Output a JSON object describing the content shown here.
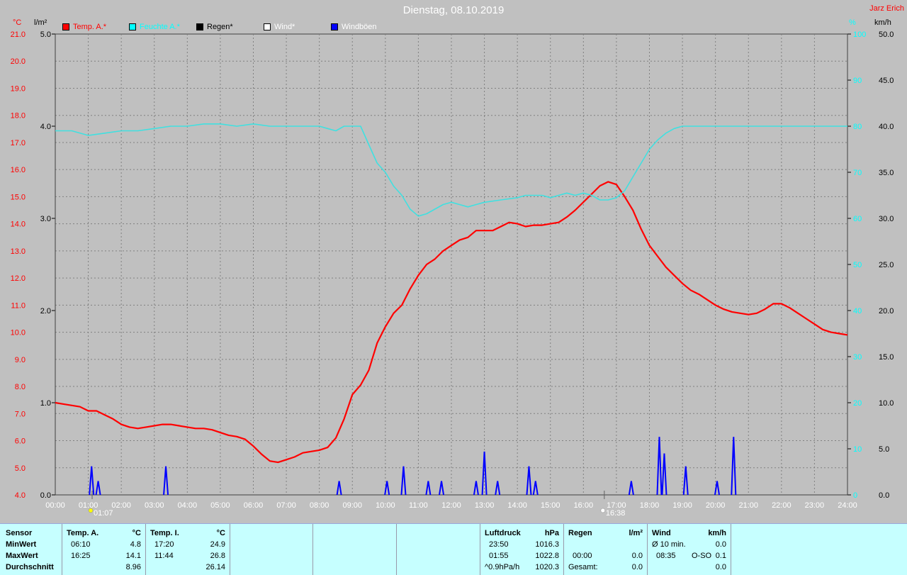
{
  "header": {
    "title": "Dienstag, 08.10.2019",
    "author": "Jarz Erich"
  },
  "units": {
    "temp": "°C",
    "rain": "l/m²",
    "humidity": "%",
    "wind": "km/h"
  },
  "legend": [
    {
      "label": "Temp. A.*",
      "color": "#ff0000"
    },
    {
      "label": "Feuchte A.*",
      "color": "#00ffff"
    },
    {
      "label": "Regen*",
      "color": "#000000"
    },
    {
      "label": "Wind*",
      "color": "#ffffff"
    },
    {
      "label": "Windböen",
      "color": "#0000ff"
    }
  ],
  "colors": {
    "background": "#c0c0c0",
    "temp": "#ff0000",
    "humidity": "#40e0e0",
    "gust": "#0000ff",
    "grid": "#808080",
    "table": "#c6ffff"
  },
  "markers": {
    "sunrise": "01:07",
    "sunset": "16:38"
  },
  "chart_data": {
    "type": "line",
    "xlabel": "",
    "x_ticks": [
      "00:00",
      "01:00",
      "02:00",
      "03:00",
      "04:00",
      "05:00",
      "06:00",
      "07:00",
      "08:00",
      "09:00",
      "10:00",
      "11:00",
      "12:00",
      "13:00",
      "14:00",
      "15:00",
      "16:00",
      "17:00",
      "18:00",
      "19:00",
      "20:00",
      "21:00",
      "22:00",
      "23:00",
      "24:00"
    ],
    "y_axes": {
      "temp": {
        "unit": "°C",
        "range": [
          4.0,
          21.0
        ],
        "ticks": [
          "4.0",
          "5.0",
          "6.0",
          "7.0",
          "8.0",
          "9.0",
          "10.0",
          "11.0",
          "12.0",
          "13.0",
          "14.0",
          "15.0",
          "16.0",
          "17.0",
          "18.0",
          "19.0",
          "20.0",
          "21.0"
        ]
      },
      "rain": {
        "unit": "l/m²",
        "range": [
          0.0,
          5.0
        ],
        "ticks": [
          "0.0",
          "1.0",
          "2.0",
          "3.0",
          "4.0",
          "5.0"
        ]
      },
      "humidity": {
        "unit": "%",
        "range": [
          0,
          100
        ],
        "ticks": [
          "0",
          "10",
          "20",
          "30",
          "40",
          "50",
          "60",
          "70",
          "80",
          "90",
          "100"
        ]
      },
      "wind": {
        "unit": "km/h",
        "range": [
          0.0,
          50.0
        ],
        "ticks": [
          "0.0",
          "5.0",
          "10.0",
          "15.0",
          "20.0",
          "25.0",
          "30.0",
          "35.0",
          "40.0",
          "45.0",
          "50.0"
        ]
      }
    },
    "grid": true,
    "series": [
      {
        "name": "Temp. A.*",
        "axis": "temp",
        "points": [
          [
            0,
            7.4
          ],
          [
            0.25,
            7.35
          ],
          [
            0.5,
            7.3
          ],
          [
            0.75,
            7.25
          ],
          [
            1,
            7.1
          ],
          [
            1.25,
            7.1
          ],
          [
            1.5,
            6.95
          ],
          [
            1.75,
            6.8
          ],
          [
            2,
            6.6
          ],
          [
            2.25,
            6.5
          ],
          [
            2.5,
            6.45
          ],
          [
            2.75,
            6.5
          ],
          [
            3,
            6.55
          ],
          [
            3.25,
            6.6
          ],
          [
            3.5,
            6.6
          ],
          [
            3.75,
            6.55
          ],
          [
            4,
            6.5
          ],
          [
            4.25,
            6.45
          ],
          [
            4.5,
            6.45
          ],
          [
            4.75,
            6.4
          ],
          [
            5,
            6.3
          ],
          [
            5.25,
            6.2
          ],
          [
            5.5,
            6.15
          ],
          [
            5.75,
            6.05
          ],
          [
            6,
            5.8
          ],
          [
            6.25,
            5.5
          ],
          [
            6.5,
            5.25
          ],
          [
            6.75,
            5.2
          ],
          [
            7,
            5.3
          ],
          [
            7.25,
            5.4
          ],
          [
            7.5,
            5.55
          ],
          [
            7.75,
            5.6
          ],
          [
            8,
            5.65
          ],
          [
            8.25,
            5.75
          ],
          [
            8.5,
            6.1
          ],
          [
            8.75,
            6.8
          ],
          [
            9,
            7.7
          ],
          [
            9.25,
            8.05
          ],
          [
            9.5,
            8.6
          ],
          [
            9.75,
            9.6
          ],
          [
            10,
            10.2
          ],
          [
            10.25,
            10.7
          ],
          [
            10.5,
            11.0
          ],
          [
            10.75,
            11.6
          ],
          [
            11,
            12.1
          ],
          [
            11.25,
            12.5
          ],
          [
            11.5,
            12.7
          ],
          [
            11.75,
            13.0
          ],
          [
            12,
            13.2
          ],
          [
            12.25,
            13.4
          ],
          [
            12.5,
            13.5
          ],
          [
            12.75,
            13.75
          ],
          [
            13,
            13.75
          ],
          [
            13.25,
            13.75
          ],
          [
            13.5,
            13.9
          ],
          [
            13.75,
            14.05
          ],
          [
            14,
            14.0
          ],
          [
            14.25,
            13.9
          ],
          [
            14.5,
            13.95
          ],
          [
            14.75,
            13.95
          ],
          [
            15,
            14.0
          ],
          [
            15.25,
            14.05
          ],
          [
            15.5,
            14.25
          ],
          [
            15.75,
            14.5
          ],
          [
            16,
            14.8
          ],
          [
            16.25,
            15.1
          ],
          [
            16.5,
            15.4
          ],
          [
            16.75,
            15.55
          ],
          [
            17,
            15.45
          ],
          [
            17.25,
            15.0
          ],
          [
            17.5,
            14.5
          ],
          [
            17.75,
            13.8
          ],
          [
            18,
            13.2
          ],
          [
            18.25,
            12.8
          ],
          [
            18.5,
            12.4
          ],
          [
            18.75,
            12.1
          ],
          [
            19,
            11.8
          ],
          [
            19.25,
            11.55
          ],
          [
            19.5,
            11.4
          ],
          [
            19.75,
            11.2
          ],
          [
            20,
            11.0
          ],
          [
            20.25,
            10.85
          ],
          [
            20.5,
            10.75
          ],
          [
            20.75,
            10.7
          ],
          [
            21,
            10.65
          ],
          [
            21.25,
            10.7
          ],
          [
            21.5,
            10.85
          ],
          [
            21.75,
            11.05
          ],
          [
            22,
            11.05
          ],
          [
            22.25,
            10.9
          ],
          [
            22.5,
            10.7
          ],
          [
            22.75,
            10.5
          ],
          [
            23,
            10.3
          ],
          [
            23.25,
            10.1
          ],
          [
            23.5,
            10.0
          ],
          [
            23.75,
            9.95
          ],
          [
            24,
            9.9
          ]
        ]
      },
      {
        "name": "Feuchte A.*",
        "axis": "humidity",
        "points": [
          [
            0,
            79
          ],
          [
            0.5,
            79
          ],
          [
            1,
            78
          ],
          [
            1.5,
            78.5
          ],
          [
            2,
            79
          ],
          [
            2.5,
            79
          ],
          [
            3,
            79.5
          ],
          [
            3.5,
            80
          ],
          [
            4,
            80
          ],
          [
            4.5,
            80.5
          ],
          [
            5,
            80.5
          ],
          [
            5.5,
            80
          ],
          [
            6,
            80.5
          ],
          [
            6.5,
            80
          ],
          [
            7,
            80
          ],
          [
            7.5,
            80
          ],
          [
            8,
            80
          ],
          [
            8.25,
            79.5
          ],
          [
            8.5,
            79
          ],
          [
            8.75,
            80
          ],
          [
            9,
            80
          ],
          [
            9.25,
            80
          ],
          [
            9.5,
            76
          ],
          [
            9.75,
            72
          ],
          [
            10,
            70
          ],
          [
            10.25,
            67
          ],
          [
            10.5,
            65
          ],
          [
            10.75,
            62
          ],
          [
            11,
            60.5
          ],
          [
            11.25,
            61
          ],
          [
            11.5,
            62
          ],
          [
            11.75,
            63
          ],
          [
            12,
            63.5
          ],
          [
            12.25,
            63
          ],
          [
            12.5,
            62.5
          ],
          [
            12.75,
            63
          ],
          [
            13,
            63.5
          ],
          [
            13.5,
            64
          ],
          [
            14,
            64.5
          ],
          [
            14.25,
            65
          ],
          [
            14.5,
            65
          ],
          [
            14.75,
            65
          ],
          [
            15,
            64.5
          ],
          [
            15.25,
            65
          ],
          [
            15.5,
            65.5
          ],
          [
            15.75,
            65
          ],
          [
            16,
            65.5
          ],
          [
            16.25,
            65
          ],
          [
            16.5,
            64
          ],
          [
            16.75,
            64
          ],
          [
            17,
            64.5
          ],
          [
            17.25,
            66
          ],
          [
            17.5,
            69
          ],
          [
            17.75,
            72
          ],
          [
            18,
            75
          ],
          [
            18.25,
            77
          ],
          [
            18.5,
            78.5
          ],
          [
            18.75,
            79.5
          ],
          [
            19,
            80
          ],
          [
            19.5,
            80
          ],
          [
            20,
            80
          ],
          [
            21,
            80
          ],
          [
            22,
            80
          ],
          [
            23,
            80
          ],
          [
            24,
            80
          ]
        ]
      }
    ],
    "gusts": {
      "name": "Windböen",
      "axis": "wind",
      "events": [
        [
          1.1,
          3.1
        ],
        [
          1.3,
          1.5
        ],
        [
          3.35,
          3.1
        ],
        [
          8.6,
          1.5
        ],
        [
          10.05,
          1.5
        ],
        [
          10.55,
          3.1
        ],
        [
          11.3,
          1.5
        ],
        [
          11.7,
          1.5
        ],
        [
          12.75,
          1.5
        ],
        [
          13.0,
          4.7
        ],
        [
          13.4,
          1.5
        ],
        [
          14.35,
          3.1
        ],
        [
          14.55,
          1.5
        ],
        [
          17.45,
          1.5
        ],
        [
          18.3,
          6.3
        ],
        [
          18.45,
          4.5
        ],
        [
          19.1,
          3.1
        ],
        [
          20.05,
          1.5
        ],
        [
          20.55,
          6.3
        ]
      ]
    }
  },
  "table": {
    "sensor_col": {
      "header": "Sensor",
      "rows": [
        "MinWert",
        "MaxWert",
        "Durchschnitt"
      ]
    },
    "temp_a": {
      "header": "Temp. A.",
      "unit": "°C",
      "times": [
        "06:10",
        "16:25",
        ""
      ],
      "values": [
        "4.8",
        "14.1",
        "8.96"
      ]
    },
    "temp_i": {
      "header": "Temp. I.",
      "unit": "°C",
      "times": [
        "17:20",
        "11:44",
        ""
      ],
      "values": [
        "24.9",
        "26.8",
        "26.14"
      ]
    },
    "pressure": {
      "header": "Luftdruck",
      "unit": "hPa",
      "times": [
        "23:50",
        "01:55",
        "^0.9hPa/h"
      ],
      "values": [
        "1016.3",
        "1022.8",
        "1020.3"
      ]
    },
    "rain": {
      "header": "Regen",
      "unit": "l/m²",
      "times": [
        "",
        "00:00",
        "Gesamt:"
      ],
      "values": [
        "",
        "0.0",
        "0.0"
      ]
    },
    "wind": {
      "header": "Wind",
      "unit": "km/h",
      "times": [
        "Ø 10 min.",
        "08:35",
        ""
      ],
      "dirs": [
        "",
        "O-SO",
        ""
      ],
      "values": [
        "0.0",
        "0.1",
        "0.0"
      ]
    }
  }
}
